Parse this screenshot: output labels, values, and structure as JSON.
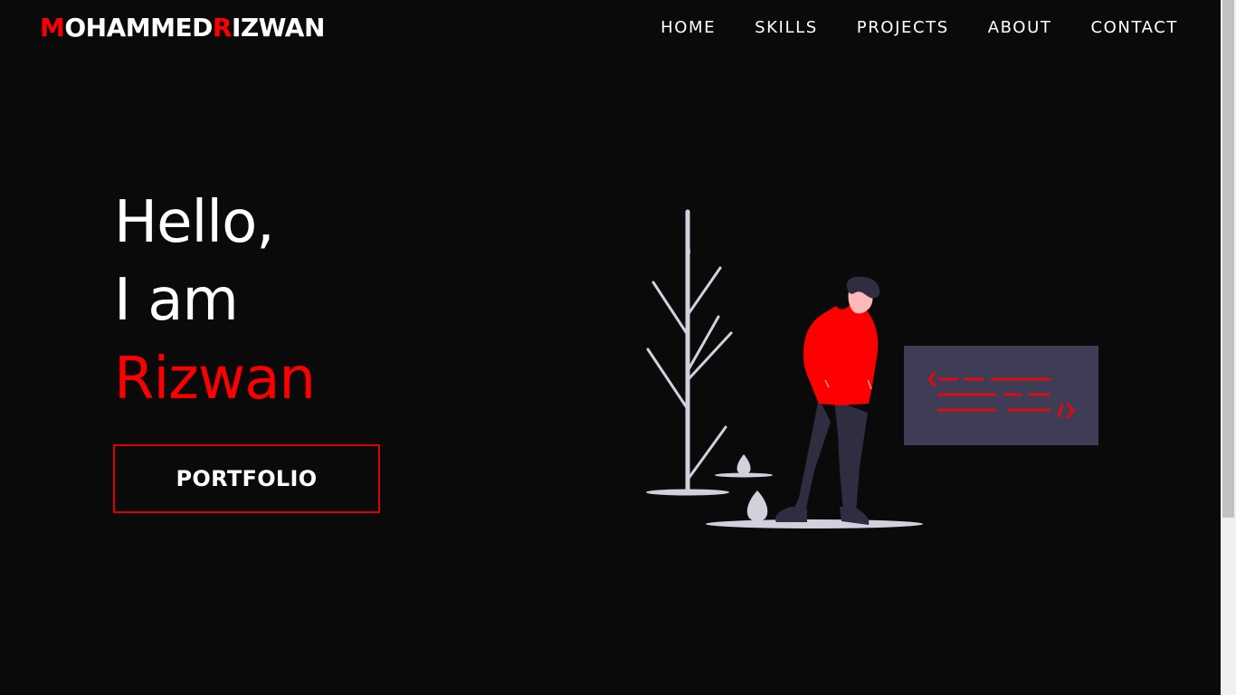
{
  "header": {
    "logo": {
      "first_initial": "M",
      "first_rest": "OHAMMED",
      "last_initial": "R",
      "last_rest": "IZWAN"
    },
    "nav": [
      {
        "label": "HOME"
      },
      {
        "label": "SKILLS"
      },
      {
        "label": "PROJECTS"
      },
      {
        "label": "ABOUT"
      },
      {
        "label": "CONTACT"
      }
    ]
  },
  "hero": {
    "greeting": "Hello,",
    "intro": "I am",
    "name": "Rizwan",
    "button_label": "PORTFOLIO"
  },
  "illustration": {
    "icon": "developer-illustration",
    "code_symbols": {
      "open": "<",
      "close": "/>"
    }
  },
  "colors": {
    "background": "#0a0a0b",
    "accent": "#ff0000",
    "text": "#ffffff",
    "panel": "#3f3d56",
    "plant": "#d2d0dc"
  }
}
